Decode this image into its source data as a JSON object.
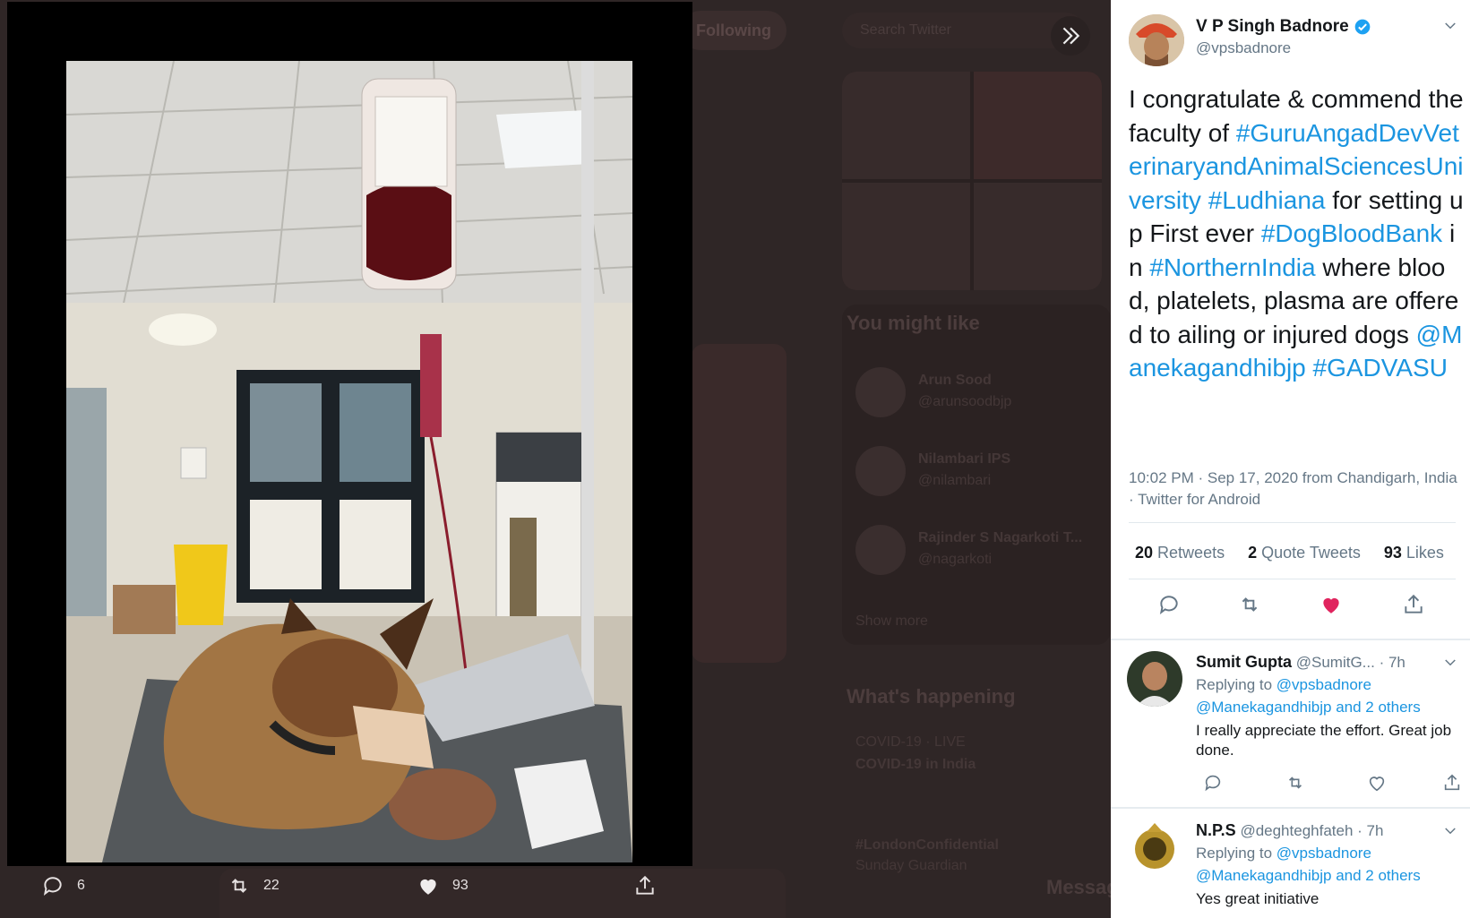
{
  "background": {
    "follow_pill": "Following",
    "search_placeholder": "Search Twitter",
    "you_might_like": "You might like",
    "suggestions": [
      {
        "name": "Arun Sood",
        "handle": "@arunsoodbjp"
      },
      {
        "name": "Nilambari IPS",
        "handle": "@nilambari"
      },
      {
        "name": "Rajinder S Nagarkoti T...",
        "handle": "@nagarkoti"
      }
    ],
    "show_more": "Show more",
    "whats_happening": "What's happening",
    "trend_1_context": "COVID-19 · LIVE",
    "trend_1_title": "COVID-19 in India",
    "trend_2_tag": "#LondonConfidential",
    "trend_2_sub": "Sunday Guardian",
    "messages": "Messages"
  },
  "lightbox": {
    "actions": {
      "replies": "6",
      "retweets": "22",
      "likes": "93"
    }
  },
  "tweet": {
    "author_name": "V P Singh Badnore",
    "author_handle": "@vpsbadnore",
    "text_parts": {
      "p1": "I congratulate & commend the faculty of ",
      "tag1": "#GuruAngadDevVeterinaryandAnimalSciencesUniversity",
      "tag2": "#Ludhiana",
      "p2": " for setting up First ever ",
      "tag3": "#DogBloodBank",
      "p3": " in ",
      "tag4": "#NorthernIndia",
      "p4": " where blood, platelets, plasma are offered to ailing or injured dogs ",
      "mention": "@Manekagandhibjp",
      "tag5": "#GADVASU"
    },
    "meta": "10:02 PM · Sep 17, 2020 from Chandigarh, India · Twitter for Android",
    "stats": {
      "retweets_count": "20",
      "retweets_label": "Retweets",
      "quotes_count": "2",
      "quotes_label": "Quote Tweets",
      "likes_count": "93",
      "likes_label": "Likes"
    },
    "liked": true,
    "like_color": "#e0245e"
  },
  "replies": [
    {
      "name": "Sumit Gupta",
      "handle": "@SumitG...",
      "time": "· 7h",
      "replying_prefix": "Replying to",
      "replying_to": "@vpsbadnore",
      "mention_line": "@Manekagandhibjp and 2 others",
      "text": "I really appreciate the effort. Great job done."
    },
    {
      "name": "N.P.S",
      "handle": "@deghteghfateh",
      "time": "· 7h",
      "replying_prefix": "Replying to",
      "replying_to": "@vpsbadnore",
      "mention_line": "@Manekagandhibjp and 2 others",
      "text": "Yes great initiative"
    }
  ],
  "colors": {
    "link": "#1b95e0",
    "secondary_text": "#657786",
    "verified": "#1da1f2"
  }
}
